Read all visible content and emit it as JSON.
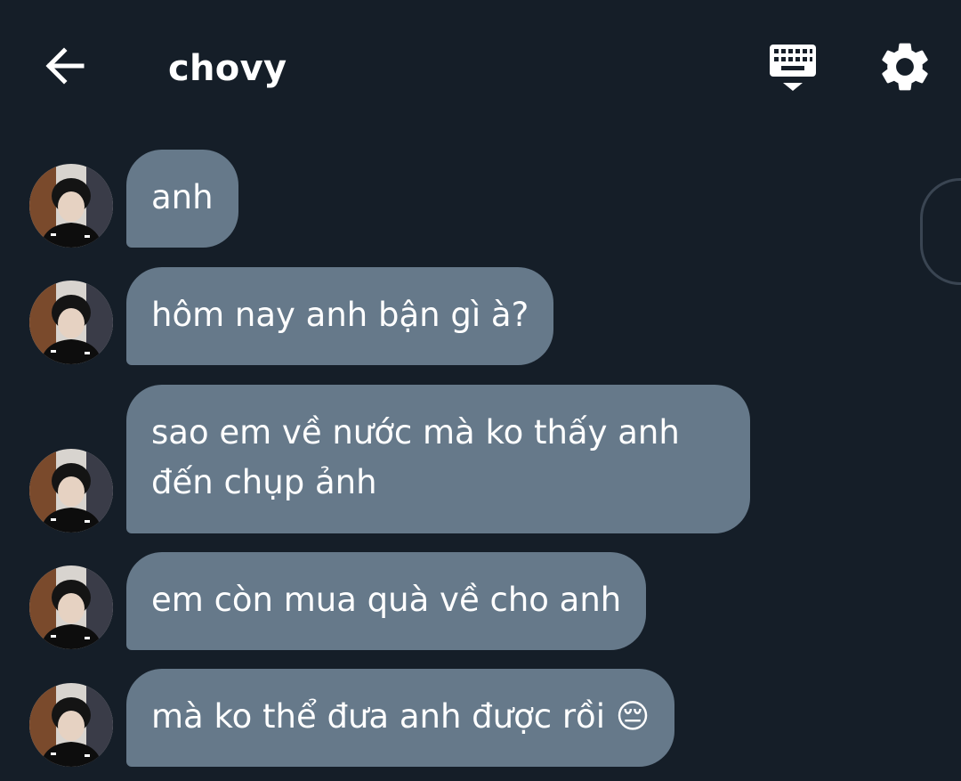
{
  "header": {
    "title": "chovy",
    "back_icon": "arrow-left-icon",
    "keyboard_icon": "keyboard-hide-icon",
    "settings_icon": "gear-icon"
  },
  "messages": [
    {
      "sender": "chovy",
      "text": "anh"
    },
    {
      "sender": "chovy",
      "text": "hôm nay anh bận gì à?"
    },
    {
      "sender": "chovy",
      "text": "sao em về nước mà ko thấy anh đến chụp ảnh"
    },
    {
      "sender": "chovy",
      "text": "em còn mua quà về cho anh"
    },
    {
      "sender": "chovy",
      "text": "mà ko thể đưa anh được rồi 😔"
    }
  ],
  "colors": {
    "background": "#151e28",
    "bubble": "#66798a",
    "text": "#ffffff"
  }
}
